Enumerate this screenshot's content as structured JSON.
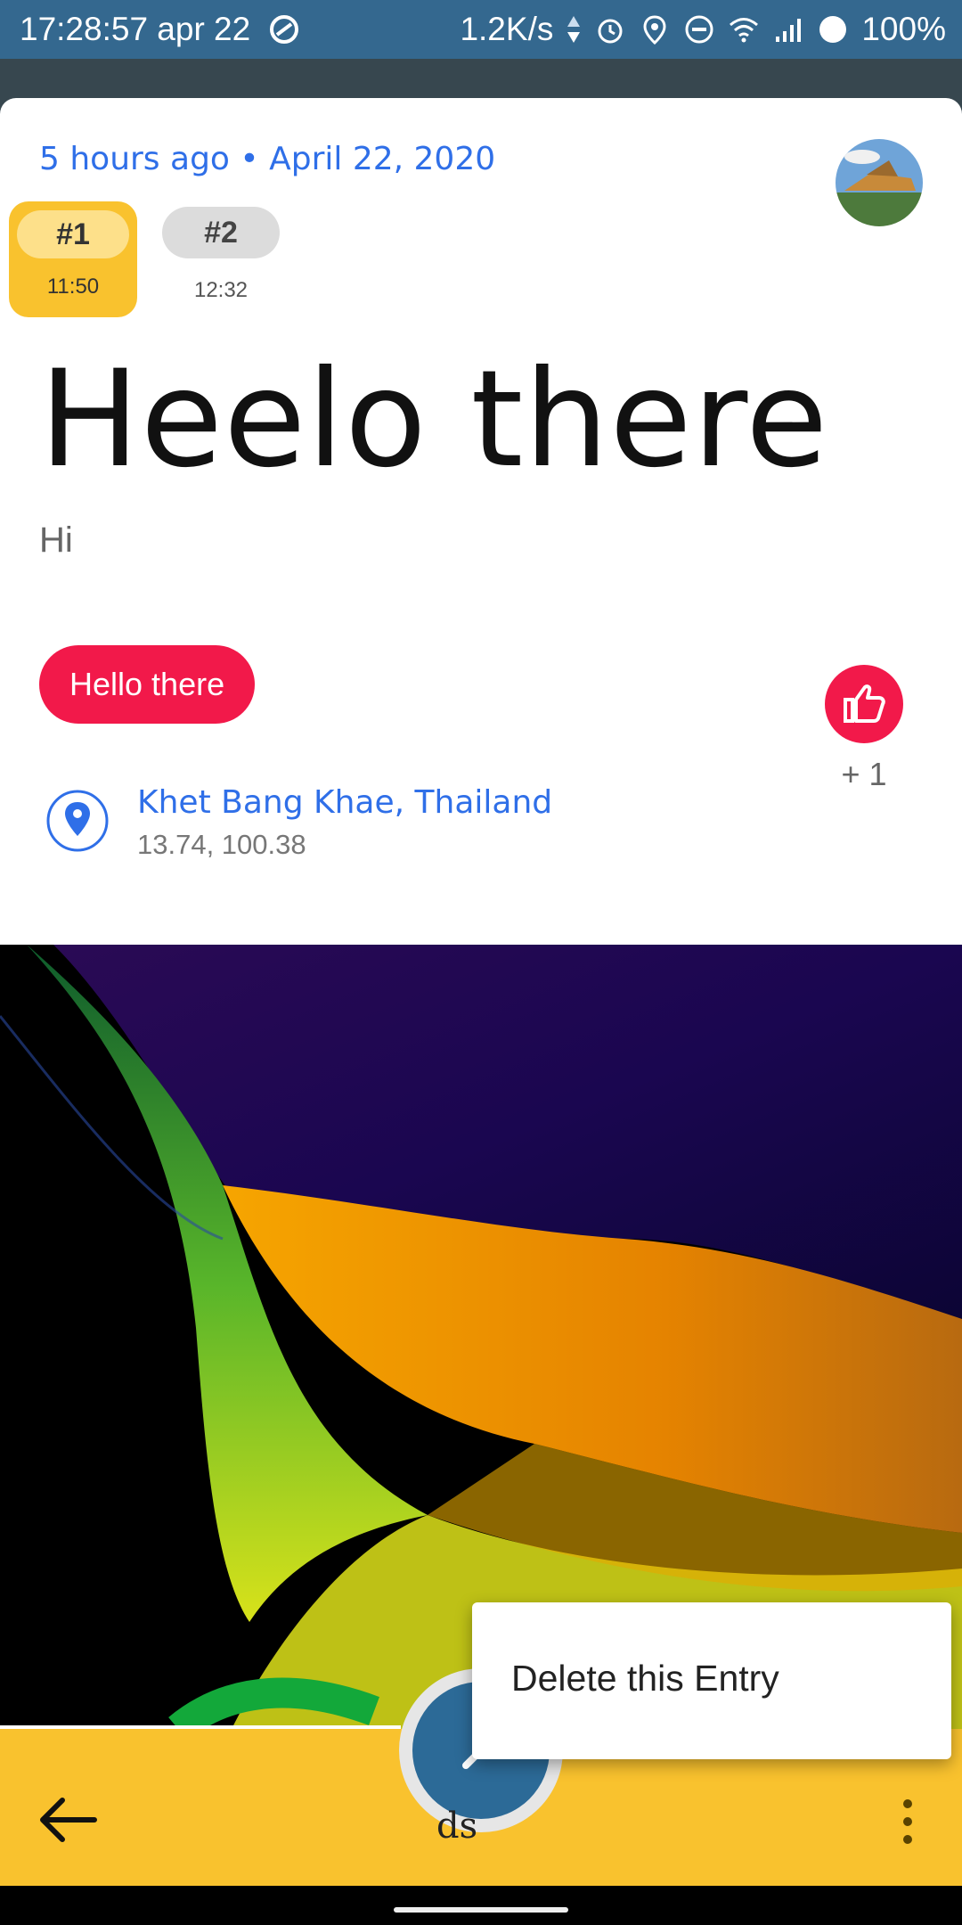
{
  "status_bar": {
    "time": "17:28:57 apr 22",
    "speed": "1.2K/s",
    "battery": "100%"
  },
  "entry": {
    "relative_time": "5 hours ago",
    "date": "April 22, 2020",
    "tabs": [
      {
        "label": "#1",
        "time": "11:50"
      },
      {
        "label": "#2",
        "time": "12:32"
      }
    ],
    "title": "Heelo there",
    "body": "Hi",
    "tag": "Hello there",
    "like_count": "+ 1",
    "location": {
      "name": "Khet Bang Khae, Thailand",
      "coords": "13.74, 100.38"
    }
  },
  "fab": {
    "partial_text": "ds"
  },
  "menu": {
    "items": [
      "Delete this Entry"
    ]
  },
  "colors": {
    "status_bar": "#34688f",
    "accent_blue": "#2f6fe8",
    "tag_red": "#f2194a",
    "bar_yellow": "#f9c22e",
    "fab_blue": "#2c6a97"
  }
}
